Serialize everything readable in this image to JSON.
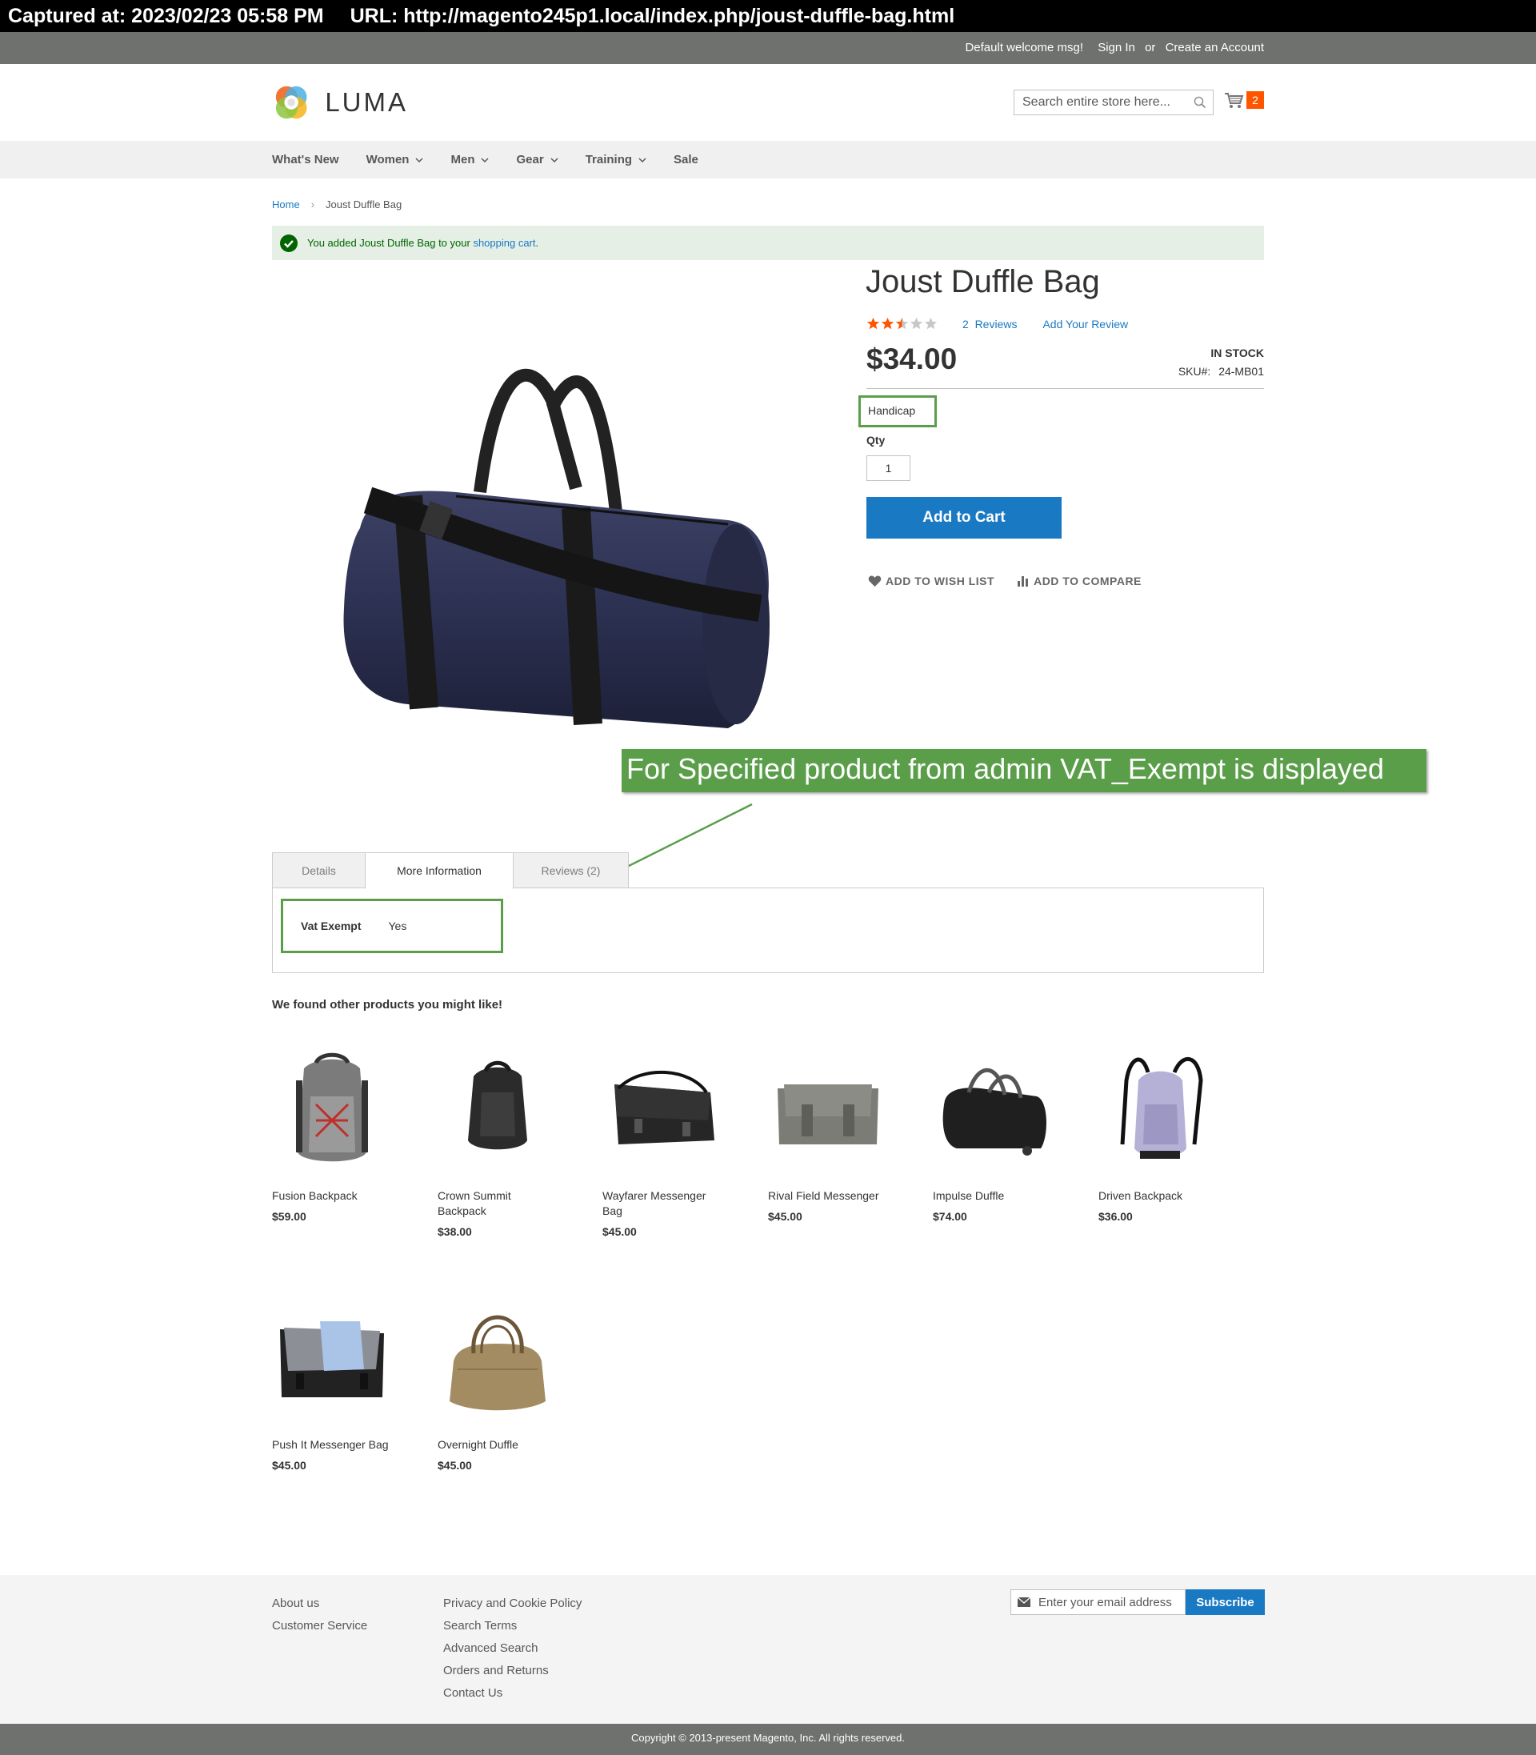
{
  "capture": {
    "captured_at": "Captured at: 2023/02/23 05:58 PM",
    "url": "URL: http://magento245p1.local/index.php/joust-duffle-bag.html"
  },
  "panel": {
    "welcome": "Default welcome msg!",
    "sign_in": "Sign In",
    "or": "or",
    "create_account": "Create an Account"
  },
  "header": {
    "logo_text": "LUMA",
    "search_placeholder": "Search entire store here...",
    "cart_count": "2"
  },
  "nav": {
    "items": [
      {
        "label": "What's New",
        "has_dropdown": false
      },
      {
        "label": "Women",
        "has_dropdown": true
      },
      {
        "label": "Men",
        "has_dropdown": true
      },
      {
        "label": "Gear",
        "has_dropdown": true
      },
      {
        "label": "Training",
        "has_dropdown": true
      },
      {
        "label": "Sale",
        "has_dropdown": false
      }
    ]
  },
  "breadcrumb": {
    "home": "Home",
    "current": "Joust Duffle Bag"
  },
  "message": {
    "prefix": "You added Joust Duffle Bag to your ",
    "link": "shopping cart",
    "suffix": "."
  },
  "product": {
    "title": "Joust Duffle Bag",
    "rating_stars": 2.5,
    "reviews_link": "2  Reviews",
    "add_review": "Add Your Review",
    "price": "$34.00",
    "stock": "IN STOCK",
    "sku_label": "SKU#:",
    "sku": "24-MB01",
    "option": "Handicap",
    "qty_label": "Qty",
    "qty_value": "1",
    "add_to_cart": "Add to Cart",
    "wishlist": "ADD TO WISH LIST",
    "compare": "ADD TO COMPARE"
  },
  "annotation": {
    "text": "For Specified product from admin VAT_Exempt is displayed",
    "color": "#5a9e4a"
  },
  "tabs": {
    "details": "Details",
    "more_info": "More Information",
    "reviews": "Reviews (2)",
    "vat_label": "Vat Exempt",
    "vat_value": "Yes"
  },
  "related": {
    "title": "We found other products you might like!",
    "products": [
      {
        "name": "Fusion Backpack",
        "price": "$59.00"
      },
      {
        "name": "Crown Summit Backpack",
        "price": "$38.00"
      },
      {
        "name": "Wayfarer Messenger Bag",
        "price": "$45.00"
      },
      {
        "name": "Rival Field Messenger",
        "price": "$45.00"
      },
      {
        "name": "Impulse Duffle",
        "price": "$74.00"
      },
      {
        "name": "Driven Backpack",
        "price": "$36.00"
      },
      {
        "name": "Push It Messenger Bag",
        "price": "$45.00"
      },
      {
        "name": "Overnight Duffle",
        "price": "$45.00"
      }
    ]
  },
  "footer": {
    "col1": [
      "About us",
      "Customer Service"
    ],
    "col2": [
      "Privacy and Cookie Policy",
      "Search Terms",
      "Advanced Search",
      "Orders and Returns",
      "Contact Us"
    ],
    "newsletter_placeholder": "Enter your email address",
    "subscribe": "Subscribe",
    "copyright": "Copyright © 2013-present Magento, Inc. All rights reserved."
  },
  "colors": {
    "accent_blue": "#1979c3",
    "cart_badge": "#ff5501",
    "success_bg": "#e5efe5",
    "annotation_green": "#5a9e4a"
  }
}
